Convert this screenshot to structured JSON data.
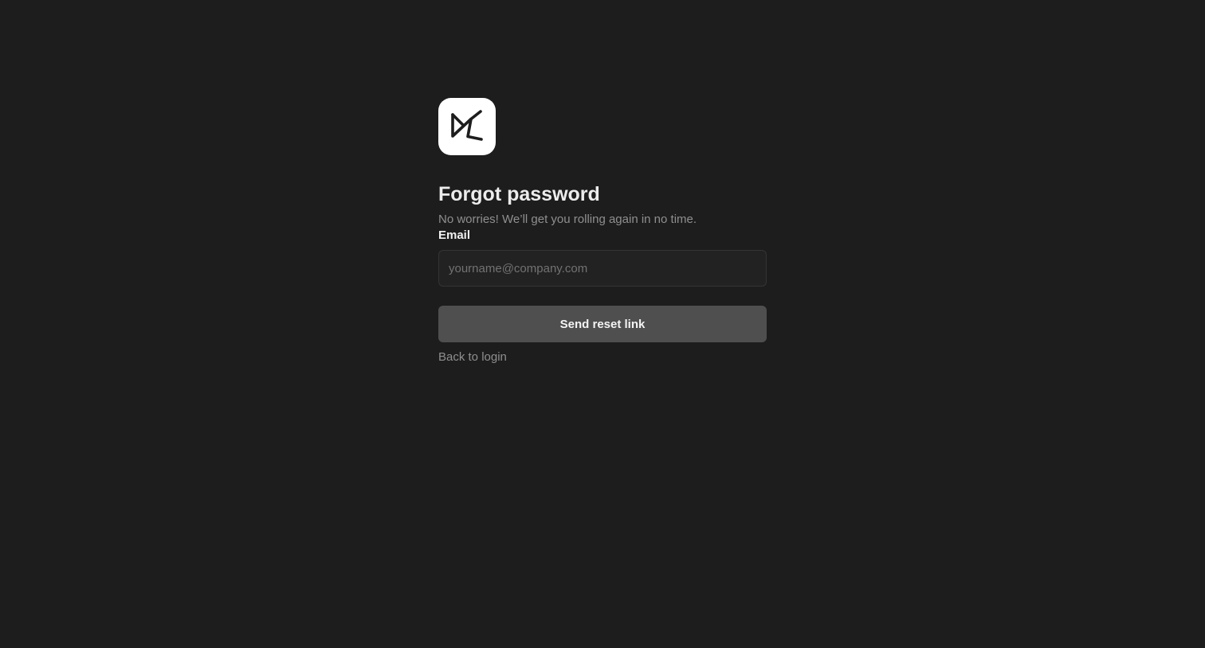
{
  "app": {
    "logo_icon": "app-logo-icon",
    "logo_background": "#ffffff",
    "logo_stroke": "#1d1d1d"
  },
  "header": {
    "title": "Forgot password",
    "subtitle": "No worries! We’ll get you rolling again in no time."
  },
  "form": {
    "email_label": "Email",
    "email_value": "",
    "email_placeholder": "yourname@company.com",
    "submit_label": "Send reset link"
  },
  "footer": {
    "back_link_label": "Back to login"
  },
  "colors": {
    "background": "#1d1d1d",
    "button_background": "#4f4f4f",
    "input_background": "#222222",
    "muted_text": "#8f8f8f"
  }
}
